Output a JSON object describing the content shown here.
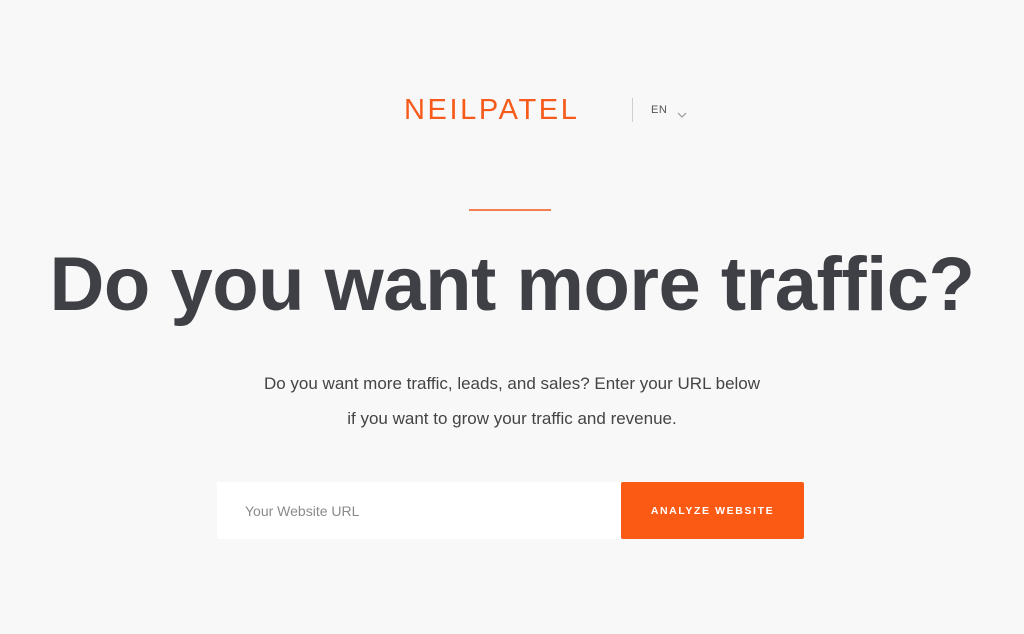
{
  "header": {
    "logo_text": "NEILPATEL",
    "language": "EN",
    "language_icon": "chevron-down-icon"
  },
  "hero": {
    "headline": "Do you want more traffic?",
    "subtext_line1": "Do you want more traffic, leads, and sales? Enter your URL below",
    "subtext_line2": "if you want to grow your traffic and revenue."
  },
  "form": {
    "url_placeholder": "Your Website URL",
    "url_value": "",
    "submit_label": "ANALYZE WEBSITE"
  },
  "colors": {
    "brand_orange": "#f75b1c",
    "button_orange": "#fb5a15",
    "headline_text": "#3f4046",
    "background": "#f8f8f8"
  }
}
